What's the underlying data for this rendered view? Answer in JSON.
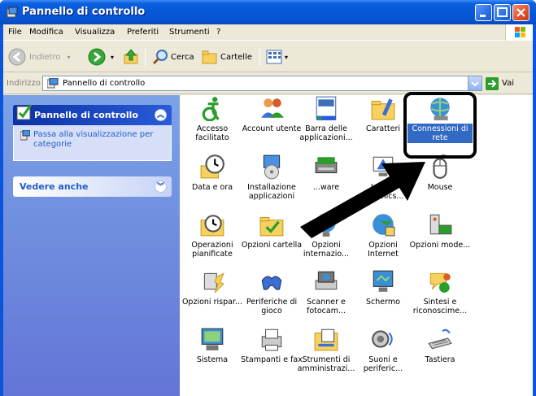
{
  "window": {
    "title": "Pannello di controllo"
  },
  "menu": [
    "File",
    "Modifica",
    "Visualizza",
    "Preferiti",
    "Strumenti",
    "?"
  ],
  "toolbar": {
    "back": "Indietro",
    "search": "Cerca",
    "folders": "Cartelle"
  },
  "address": {
    "label": "Indirizzo",
    "value": "Pannello di controllo",
    "go": "Vai"
  },
  "taskpane": {
    "panel1_title": "Pannello di controllo",
    "panel1_link": "Passa alla visualizzazione per categorie",
    "panel2_title": "Vedere anche"
  },
  "items": [
    {
      "label": "Accesso facilitato",
      "icon": "accessibility-icon"
    },
    {
      "label": "Account utente",
      "icon": "user-accounts-icon"
    },
    {
      "label": "Barra delle applicazioni...",
      "icon": "taskbar-icon"
    },
    {
      "label": "Caratteri",
      "icon": "fonts-folder-icon"
    },
    {
      "label": "Connessioni di rete",
      "icon": "network-connections-icon",
      "selected": true
    },
    {
      "label": "Data e ora",
      "icon": "clock-icon"
    },
    {
      "label": "Installazione applicazioni",
      "icon": "add-remove-programs-icon"
    },
    {
      "label": "...ware",
      "icon": "hardware-icon"
    },
    {
      "label": "Intel® Graphics...",
      "icon": "intel-graphics-icon"
    },
    {
      "label": "Mouse",
      "icon": "mouse-icon"
    },
    {
      "label": "Operazioni pianificate",
      "icon": "scheduled-tasks-icon"
    },
    {
      "label": "Opzioni cartella",
      "icon": "folder-options-icon"
    },
    {
      "label": "Opzioni internazio...",
      "icon": "regional-options-icon"
    },
    {
      "label": "Opzioni Internet",
      "icon": "internet-options-icon"
    },
    {
      "label": "Opzioni mode...",
      "icon": "modem-options-icon"
    },
    {
      "label": "Opzioni rispar...",
      "icon": "power-options-icon"
    },
    {
      "label": "Periferiche di gioco",
      "icon": "game-controller-icon"
    },
    {
      "label": "Scanner e fotocam...",
      "icon": "scanner-camera-icon"
    },
    {
      "label": "Schermo",
      "icon": "display-icon"
    },
    {
      "label": "Sintesi e riconoscime...",
      "icon": "speech-icon"
    },
    {
      "label": "Sistema",
      "icon": "system-icon"
    },
    {
      "label": "Stampanti e fax",
      "icon": "printers-fax-icon"
    },
    {
      "label": "Strumenti di amministrazi...",
      "icon": "admin-tools-icon"
    },
    {
      "label": "Suoni e periferic...",
      "icon": "sounds-icon"
    },
    {
      "label": "Tastiera",
      "icon": "keyboard-icon"
    }
  ],
  "colors": {
    "titlebar": "#0758d8",
    "selection": "#316ac5",
    "link": "#215dc6"
  }
}
